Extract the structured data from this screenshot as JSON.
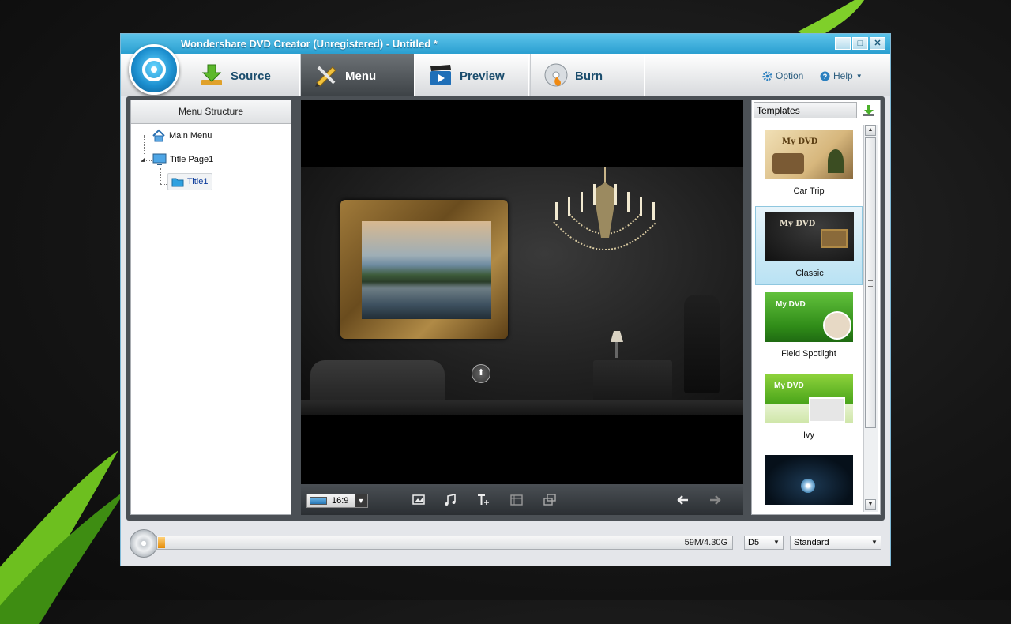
{
  "window": {
    "title": "Wondershare DVD Creator (Unregistered) - Untitled *",
    "controls": [
      "_",
      "□",
      "✕"
    ]
  },
  "nav": {
    "tabs": [
      {
        "label": "Source",
        "active": false
      },
      {
        "label": "Menu",
        "active": true
      },
      {
        "label": "Preview",
        "active": false
      },
      {
        "label": "Burn",
        "active": false
      }
    ],
    "option_label": "Option",
    "help_label": "Help"
  },
  "menu_structure": {
    "header": "Menu Structure",
    "items": [
      "Main Menu",
      "Title Page1",
      "Title1"
    ]
  },
  "preview": {
    "aspect_ratio": "16:9"
  },
  "templates": {
    "header": "Templates",
    "items": [
      {
        "name": "Car Trip",
        "thumb_title": "My DVD",
        "selected": false
      },
      {
        "name": "Classic",
        "thumb_title": "My DVD",
        "selected": true
      },
      {
        "name": "Field Spotlight",
        "thumb_title": "My DVD",
        "selected": false
      },
      {
        "name": "Ivy",
        "thumb_title": "My DVD",
        "selected": false
      },
      {
        "name": "",
        "thumb_title": "",
        "selected": false
      }
    ]
  },
  "bottom": {
    "capacity_text": "59M/4.30G",
    "capacity_fraction": 0.012,
    "disc_type": "D5",
    "quality": "Standard"
  },
  "colors": {
    "accent": "#2a9fd1",
    "active_tab": "#4a4f54",
    "progress": "#e48c08"
  }
}
